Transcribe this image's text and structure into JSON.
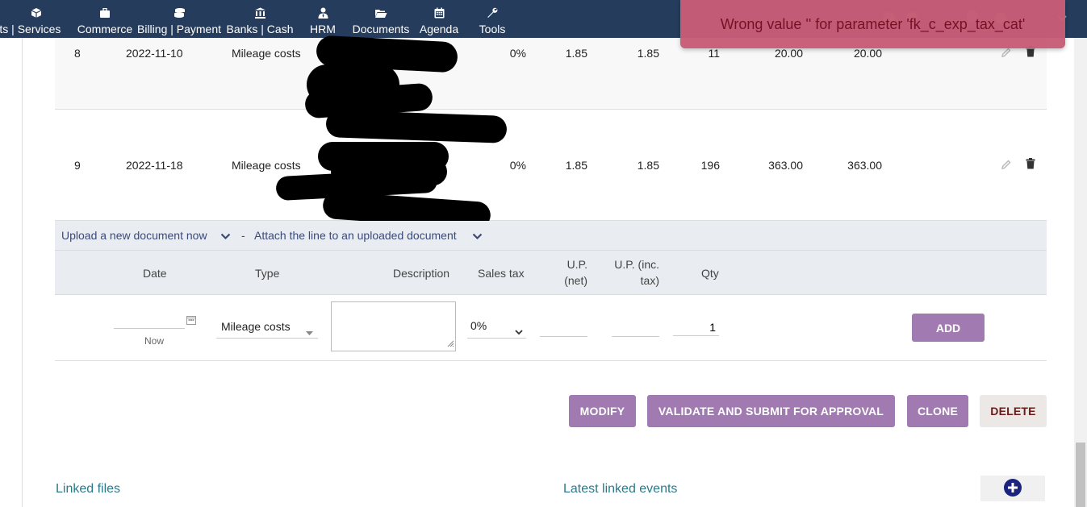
{
  "nav": {
    "items": [
      {
        "label": "ucts | Services",
        "icon": "cube-icon"
      },
      {
        "label": "Commerce",
        "icon": "briefcase-icon"
      },
      {
        "label": "Billing | Payment",
        "icon": "coins-icon"
      },
      {
        "label": "Banks | Cash",
        "icon": "bank-icon"
      },
      {
        "label": "HRM",
        "icon": "user-tie-icon"
      },
      {
        "label": "Documents",
        "icon": "folder-open-icon"
      },
      {
        "label": "Agenda",
        "icon": "calendar-icon"
      },
      {
        "label": "Tools",
        "icon": "wrench-icon"
      }
    ]
  },
  "toast": {
    "message": "Wrong value '' for parameter 'fk_c_exp_tax_cat'"
  },
  "lines": [
    {
      "num": "8",
      "date": "2022-11-10",
      "type": "Mileage costs",
      "tax": "0%",
      "up_net": "1.85",
      "up_inc": "1.85",
      "qty": "11",
      "total_net": "20.00",
      "total_inc": "20.00"
    },
    {
      "num": "9",
      "date": "2022-11-18",
      "type": "Mileage costs",
      "tax": "0%",
      "up_net": "1.85",
      "up_inc": "1.85",
      "qty": "196",
      "total_net": "363.00",
      "total_inc": "363.00"
    }
  ],
  "upload": {
    "new_doc": "Upload a new document now",
    "separator": "-",
    "attach": "Attach the line to an uploaded document"
  },
  "headers": {
    "date": "Date",
    "type": "Type",
    "description": "Description",
    "sales_tax": "Sales tax",
    "up_net_1": "U.P.",
    "up_net_2": "(net)",
    "up_inc_1": "U.P. (inc.",
    "up_inc_2": "tax)",
    "qty": "Qty"
  },
  "new_line": {
    "date_value": "",
    "now_link": "Now",
    "type_selected": "Mileage costs",
    "description": "",
    "tax_selected": "0%",
    "up_net": "",
    "up_inc": "",
    "qty": "1",
    "add_label": "ADD"
  },
  "actions": {
    "modify": "MODIFY",
    "validate": "VALIDATE AND SUBMIT FOR APPROVAL",
    "clone": "CLONE",
    "delete": "DELETE"
  },
  "sections": {
    "linked_files": "Linked files",
    "latest_events": "Latest linked events"
  },
  "colors": {
    "nav_bg": "#263c5c",
    "button": "#a07ab0",
    "toast_bg": "#c85d77",
    "link": "#3a4a7a",
    "section": "#2a7a8a"
  }
}
